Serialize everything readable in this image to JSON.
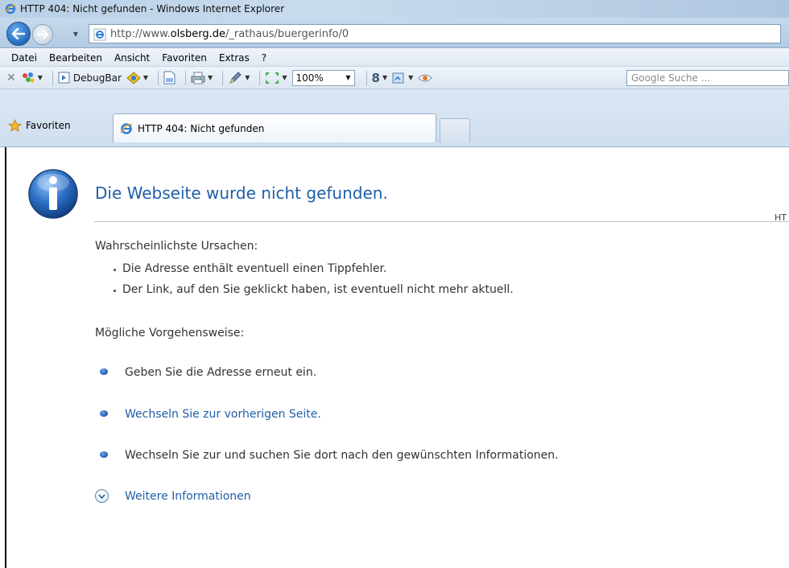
{
  "window": {
    "title": "HTTP 404: Nicht gefunden - Windows Internet Explorer"
  },
  "address": {
    "url_prefix": "http://www.",
    "url_domain": "olsberg.de",
    "url_path": "/_rathaus/buergerinfo/0"
  },
  "menu": {
    "items": [
      "Datei",
      "Bearbeiten",
      "Ansicht",
      "Favoriten",
      "Extras",
      "?"
    ]
  },
  "toolbar": {
    "debugbar_label": "DebugBar",
    "zoom_value": "100%",
    "search_placeholder": "Google Suche ..."
  },
  "tabs": {
    "favorites_label": "Favoriten",
    "active_tab_title": "HTTP 404: Nicht gefunden"
  },
  "error_page": {
    "heading": "Die Webseite wurde nicht gefunden.",
    "http_fragment": "HT",
    "causes_label": "Wahrscheinlichste Ursachen:",
    "causes": [
      "Die Adresse enthält eventuell einen Tippfehler.",
      "Der Link, auf den Sie geklickt haben, ist eventuell nicht mehr aktuell."
    ],
    "actions_label": "Mögliche Vorgehensweise:",
    "actions": [
      "Geben Sie die Adresse erneut ein.",
      "Wechseln Sie zur vorherigen Seite.",
      "Wechseln Sie zur  und suchen Sie dort nach den gewünschten Informationen."
    ],
    "more_info": "Weitere Informationen"
  },
  "colors": {
    "link_blue": "#1f5ea8",
    "text_gray": "#333333",
    "chrome_blue": "#c7d9ec"
  }
}
